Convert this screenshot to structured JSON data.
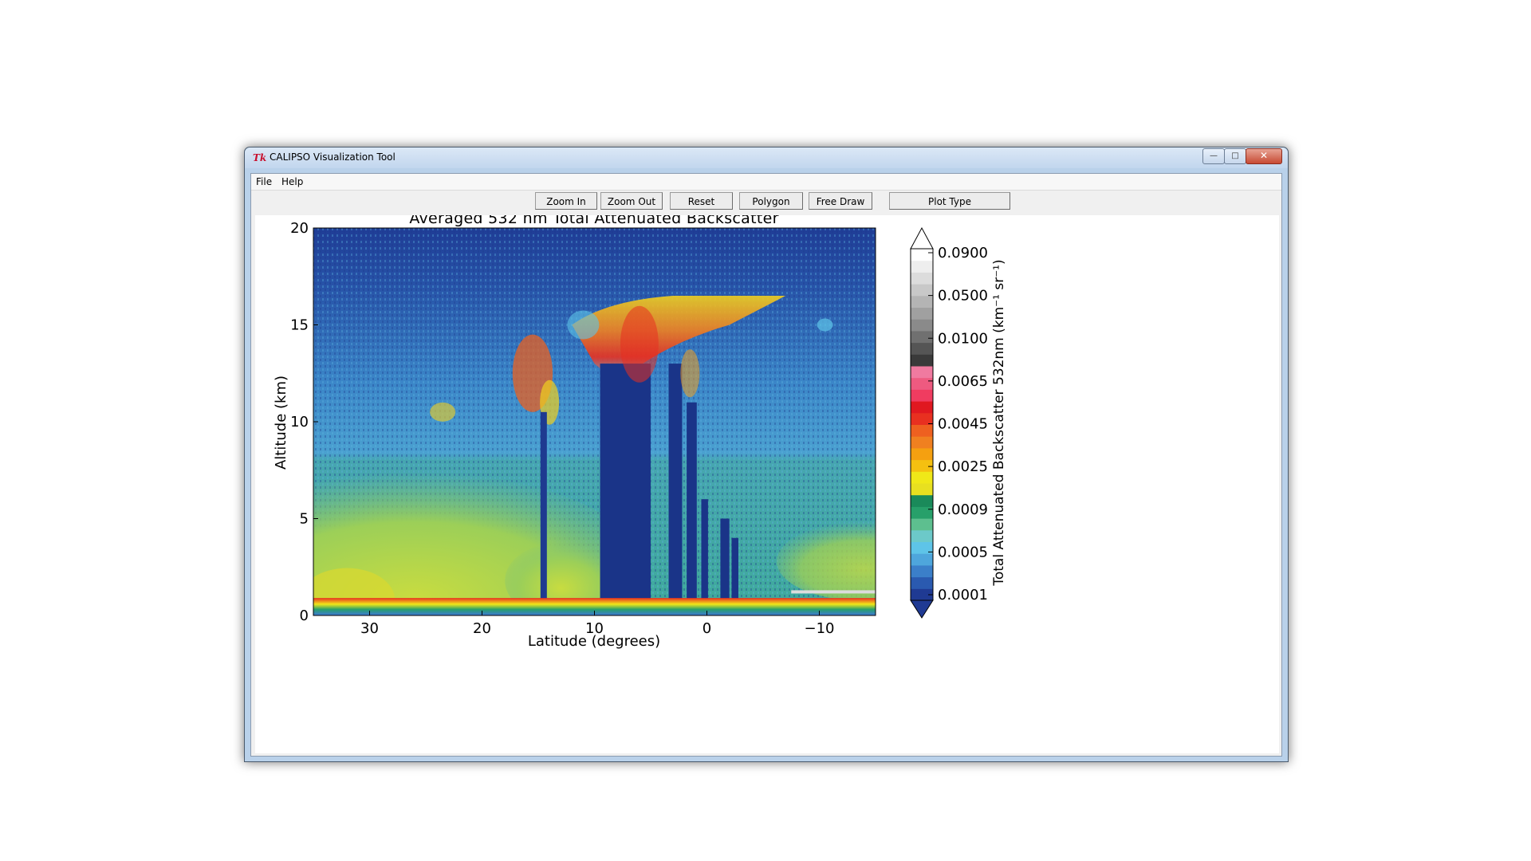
{
  "window": {
    "title": "CALIPSO Visualization Tool",
    "logo": "Tk",
    "controls": {
      "minimize": "—",
      "maximize": "□",
      "close": "✕"
    }
  },
  "menu": {
    "file": "File",
    "help": "Help"
  },
  "toolbar": {
    "zoom_in": "Zoom In",
    "zoom_out": "Zoom Out",
    "reset": "Reset",
    "polygon": "Polygon",
    "free_draw": "Free Draw",
    "plot_type": "Plot Type"
  },
  "chart_data": {
    "type": "heatmap",
    "title": "Averaged 532 nm Total Attenuated Backscatter",
    "xlabel": "Latitude (degrees)",
    "ylabel": "Altitude (km)",
    "xlim": [
      35,
      -15
    ],
    "ylim": [
      0,
      20
    ],
    "x_ticks": [
      30,
      20,
      10,
      0,
      -10
    ],
    "x_tick_labels": [
      "30",
      "20",
      "10",
      "0",
      "−10"
    ],
    "y_ticks": [
      0,
      5,
      10,
      15,
      20
    ],
    "y_tick_labels": [
      "0",
      "5",
      "10",
      "15",
      "20"
    ],
    "colorbar": {
      "label": "Total Attenuated Backscatter 532nm (km⁻¹ sr⁻¹)",
      "tick_labels": [
        "0.0001",
        "0.0005",
        "0.0009",
        "0.0025",
        "0.0045",
        "0.0065",
        "0.0100",
        "0.0500",
        "0.0900"
      ],
      "colors": [
        "#1f3a93",
        "#2a5ab0",
        "#3b7fc9",
        "#4ea6dc",
        "#5ec4e8",
        "#6cc9c9",
        "#5dbf8f",
        "#27a06a",
        "#1a8a5a",
        "#e8e020",
        "#f0e818",
        "#f5c010",
        "#f5a010",
        "#f08020",
        "#ee6020",
        "#e83020",
        "#e01820",
        "#f03c60",
        "#ee5a80",
        "#f07aa0",
        "#3a3a3a",
        "#555555",
        "#707070",
        "#8a8a8a",
        "#a0a0a0",
        "#b4b4b4",
        "#c8c8c8",
        "#dcdcdc",
        "#eeeeee",
        "#ffffff"
      ]
    },
    "features": [
      {
        "name": "surface",
        "lat_from": 35,
        "lat_to": -15,
        "alt_km": 0.3
      },
      {
        "name": "boundary-layer-aerosol",
        "lat_from": 35,
        "lat_to": 12,
        "alt_top_km": 5
      },
      {
        "name": "cirrus",
        "lat_from": 16,
        "lat_to": 13,
        "alt_bottom_km": 10,
        "alt_top_km": 14
      },
      {
        "name": "deep-convective-cloud",
        "lat_from": 10,
        "lat_to": -2,
        "alt_bottom_km": 0,
        "alt_top_km": 17
      },
      {
        "name": "anvil",
        "lat_from": 12,
        "lat_to": -7,
        "alt_bottom_km": 14,
        "alt_top_km": 16.5
      }
    ]
  }
}
